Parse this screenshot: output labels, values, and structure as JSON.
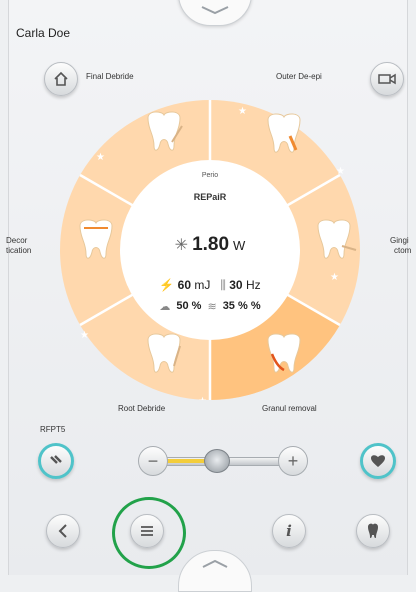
{
  "user": {
    "name": "Carla Doe"
  },
  "top_buttons": {
    "left_label": "Final Debride",
    "right_label": "Outer De-epi"
  },
  "wheel": {
    "segments": [
      {
        "label": "Final Debride"
      },
      {
        "label": "Outer De-epi"
      },
      {
        "label": "Gingi ctomy"
      },
      {
        "label": "Granul removal"
      },
      {
        "label": "Root Debride"
      },
      {
        "label": "Decor tication"
      }
    ],
    "side_left_label_1": "Decor",
    "side_left_label_2": "tication",
    "side_right_label_1": "Gingi",
    "side_right_label_2": "ctom",
    "bottom_left_label": "Root Debride",
    "bottom_right_label": "Granul removal"
  },
  "center": {
    "mode_small": "Perio",
    "mode_name": "REPaiR",
    "power_value": "1.80",
    "power_unit": "W",
    "energy": "60",
    "energy_unit": "mJ",
    "frequency": "30",
    "frequency_unit": "Hz",
    "air_pct": "50 %",
    "water_pct": "35 % %"
  },
  "left_small_label": "RFPT5",
  "icons": {
    "home": "home-icon",
    "camera": "camera-icon",
    "back": "chevron-left-icon",
    "menu": "menu-icon",
    "info": "info-icon",
    "heart": "heart-icon",
    "tooth": "tooth-icon"
  },
  "colors": {
    "accent": "#4fc3c9",
    "wheel": "#ffd8ad",
    "wheel_active": "#ffc37f",
    "highlight": "#22a24a",
    "slider_fill": "#f3cd3b"
  }
}
